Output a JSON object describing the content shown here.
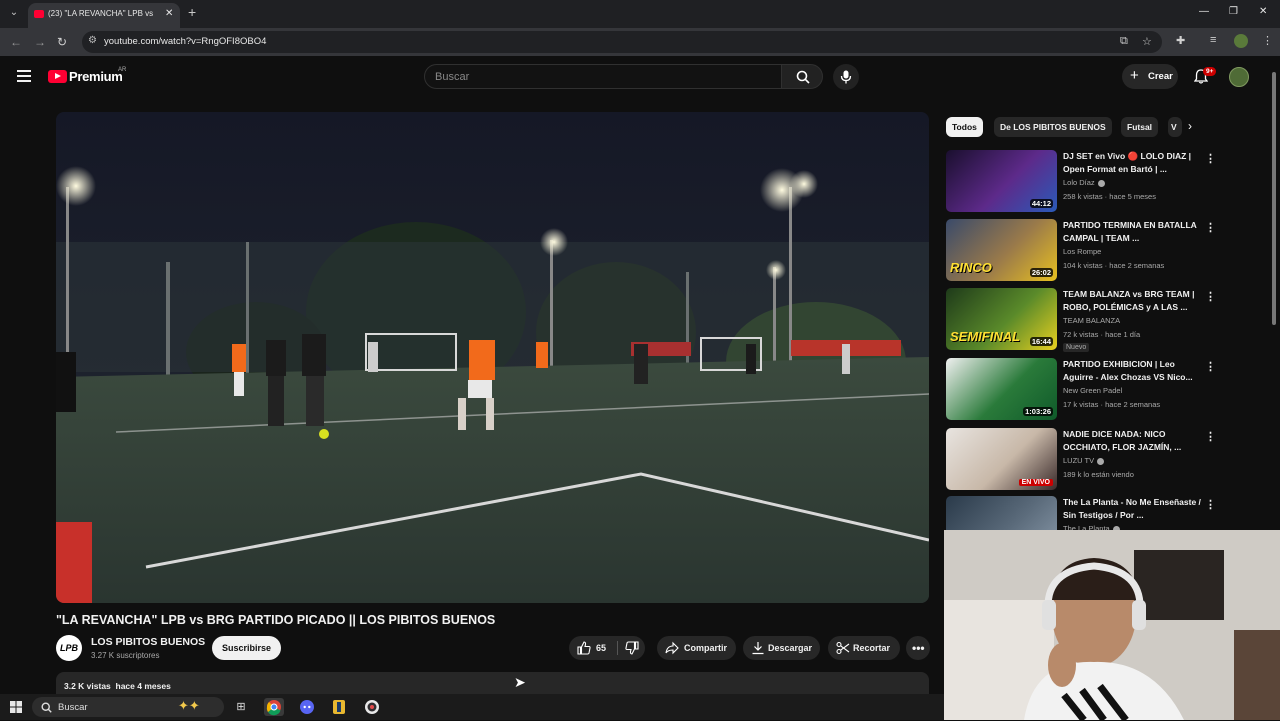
{
  "browser": {
    "tab_title": "(23) \"LA REVANCHA\" LPB vs",
    "url": "youtube.com/watch?v=RngOFI8OBO4"
  },
  "header": {
    "brand": "Premium",
    "region": "AR",
    "search_placeholder": "Buscar",
    "create_label": "Crear",
    "notifications_badge": "9+"
  },
  "video": {
    "title": "\"LA REVANCHA\" LPB vs BRG PARTIDO PICADO || LOS PIBITOS BUENOS",
    "channel": {
      "avatar_text": "LPB",
      "name": "LOS PIBITOS BUENOS",
      "subscribers": "3.27 K suscriptores",
      "subscribe_label": "Suscribirse"
    },
    "actions": {
      "likes": "65",
      "share": "Compartir",
      "download": "Descargar",
      "clip": "Recortar"
    },
    "description": {
      "views": "3.2 K vistas",
      "age": "hace 4 meses"
    }
  },
  "chips": [
    "Todos",
    "De LOS PIBITOS BUENOS",
    "Futsal",
    "V"
  ],
  "recommendations": [
    {
      "title": "DJ SET en Vivo 🔴 LOLO DIAZ | Open Format en Bartó | ...",
      "channel": "Lolo Díaz",
      "verified": true,
      "meta": "258 k vistas · hace 5 meses",
      "duration": "44:12",
      "thumb_colors": [
        "#1a0f2e",
        "#5d2a8a",
        "#2a5ab8"
      ]
    },
    {
      "title": "PARTIDO TERMINA EN BATALLA CAMPAL | TEAM ...",
      "channel": "Los Rompe",
      "verified": false,
      "meta": "104 k vistas · hace 2 semanas",
      "duration": "26:02",
      "overlay_text": "RINCO",
      "thumb_colors": [
        "#3a4a6a",
        "#9a7a4a",
        "#e8c020"
      ]
    },
    {
      "title": "TEAM BALANZA vs BRG TEAM | ROBO, POLÉMICAS y A LAS ...",
      "channel": "TEAM BALANZA",
      "verified": false,
      "meta": "72 k vistas · hace 1 día",
      "duration": "16:44",
      "new_tag": "Nuevo",
      "overlay_text": "SEMIFINAL",
      "thumb_colors": [
        "#1e3a1a",
        "#5a8a2a",
        "#e8d020"
      ]
    },
    {
      "title": "PARTIDO EXHIBICION | Leo Aguirre - Alex Chozas VS Nico...",
      "channel": "New Green Padel",
      "verified": false,
      "meta": "17 k vistas · hace 2 semanas",
      "duration": "1:03:26",
      "thumb_colors": [
        "#f0f0f0",
        "#2a7a3a",
        "#0f5a2a"
      ]
    },
    {
      "title": "NADIE DICE NADA: NICO OCCHIATO, FLOR JAZMÍN, ...",
      "channel": "LUZU TV",
      "verified": true,
      "meta": "189 k lo están viendo",
      "live": "EN VIVO",
      "thumb_colors": [
        "#e8e4e0",
        "#c8b8a8",
        "#3a2a2a"
      ]
    },
    {
      "title": "The La Planta - No Me Enseñaste / Sin Testigos / Por ...",
      "channel": "The La Planta",
      "verified": true,
      "meta": "",
      "thumb_colors": [
        "#2a3a4a",
        "#5a6a7a",
        "#8a9aaa"
      ]
    }
  ],
  "taskbar": {
    "search_label": "Buscar"
  },
  "colors": {
    "youtube_red": "#ff0033",
    "background": "#0f0f0f",
    "surface": "#272727"
  }
}
